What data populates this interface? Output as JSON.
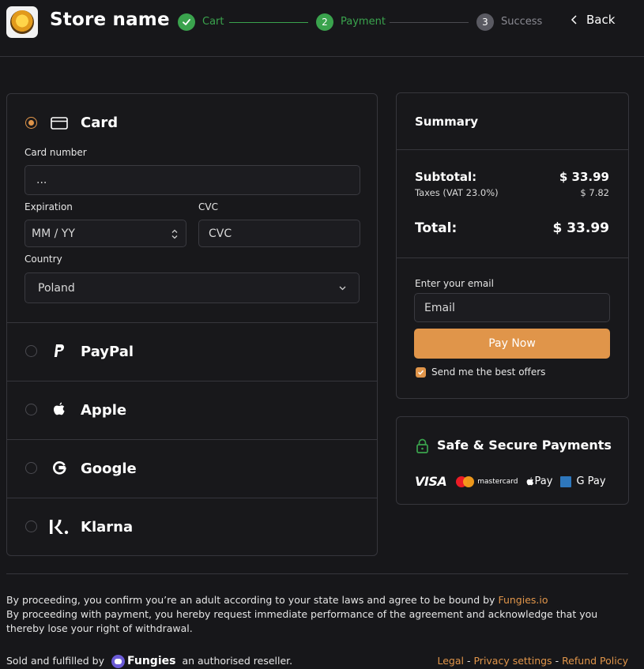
{
  "header": {
    "store_name": "Store name",
    "steps": [
      {
        "label": "Cart",
        "number": "",
        "state": "done"
      },
      {
        "label": "Payment",
        "number": "2",
        "state": "active"
      },
      {
        "label": "Success",
        "number": "3",
        "state": "pending"
      }
    ],
    "back_label": "Back"
  },
  "payment": {
    "card": {
      "label": "Card",
      "card_number_label": "Card number",
      "card_number_value": "...",
      "expiration_label": "Expiration",
      "expiration_placeholder": "MM / YY",
      "cvc_label": "CVC",
      "cvc_placeholder": "CVC",
      "country_label": "Country",
      "country_value": "Poland"
    },
    "methods": [
      {
        "label": "PayPal",
        "icon": "paypal-icon"
      },
      {
        "label": "Apple",
        "icon": "apple-icon"
      },
      {
        "label": "Google",
        "icon": "google-icon"
      },
      {
        "label": "Klarna",
        "icon": "klarna-icon"
      }
    ]
  },
  "summary": {
    "title": "Summary",
    "subtotal_label": "Subtotal:",
    "subtotal_value": "$ 33.99",
    "taxes_label": "Taxes (VAT 23.0%)",
    "taxes_value": "$ 7.82",
    "total_label": "Total:",
    "total_value": "$ 33.99",
    "email_label": "Enter your email",
    "email_placeholder": "Email",
    "pay_button": "Pay Now",
    "offers_label": "Send me the best offers",
    "offers_checked": true
  },
  "secure": {
    "title": "Safe & Secure Payments",
    "visa": "VISA",
    "mastercard": "mastercard",
    "apple_pay": "Pay",
    "google_pay": "G Pay"
  },
  "footer": {
    "line1_prefix": "By proceeding, you confirm you’re an adult according to your state laws and agree to be bound by",
    "line1_link": "Fungies.io",
    "line2": "By proceeding with payment, you hereby request immediate performance of the agreement and acknowledge that you thereby lose your right of withdrawal.",
    "sold_prefix": "Sold and fulfilled by",
    "brand": "Fungies",
    "sold_suffix": "an authorised reseller.",
    "links": [
      "Legal",
      "Privacy settings",
      "Refund Policy"
    ],
    "separator": "-"
  },
  "colors": {
    "accent": "#e0954a",
    "success": "#3aa34d",
    "background": "#17171a",
    "border": "#36363c"
  }
}
